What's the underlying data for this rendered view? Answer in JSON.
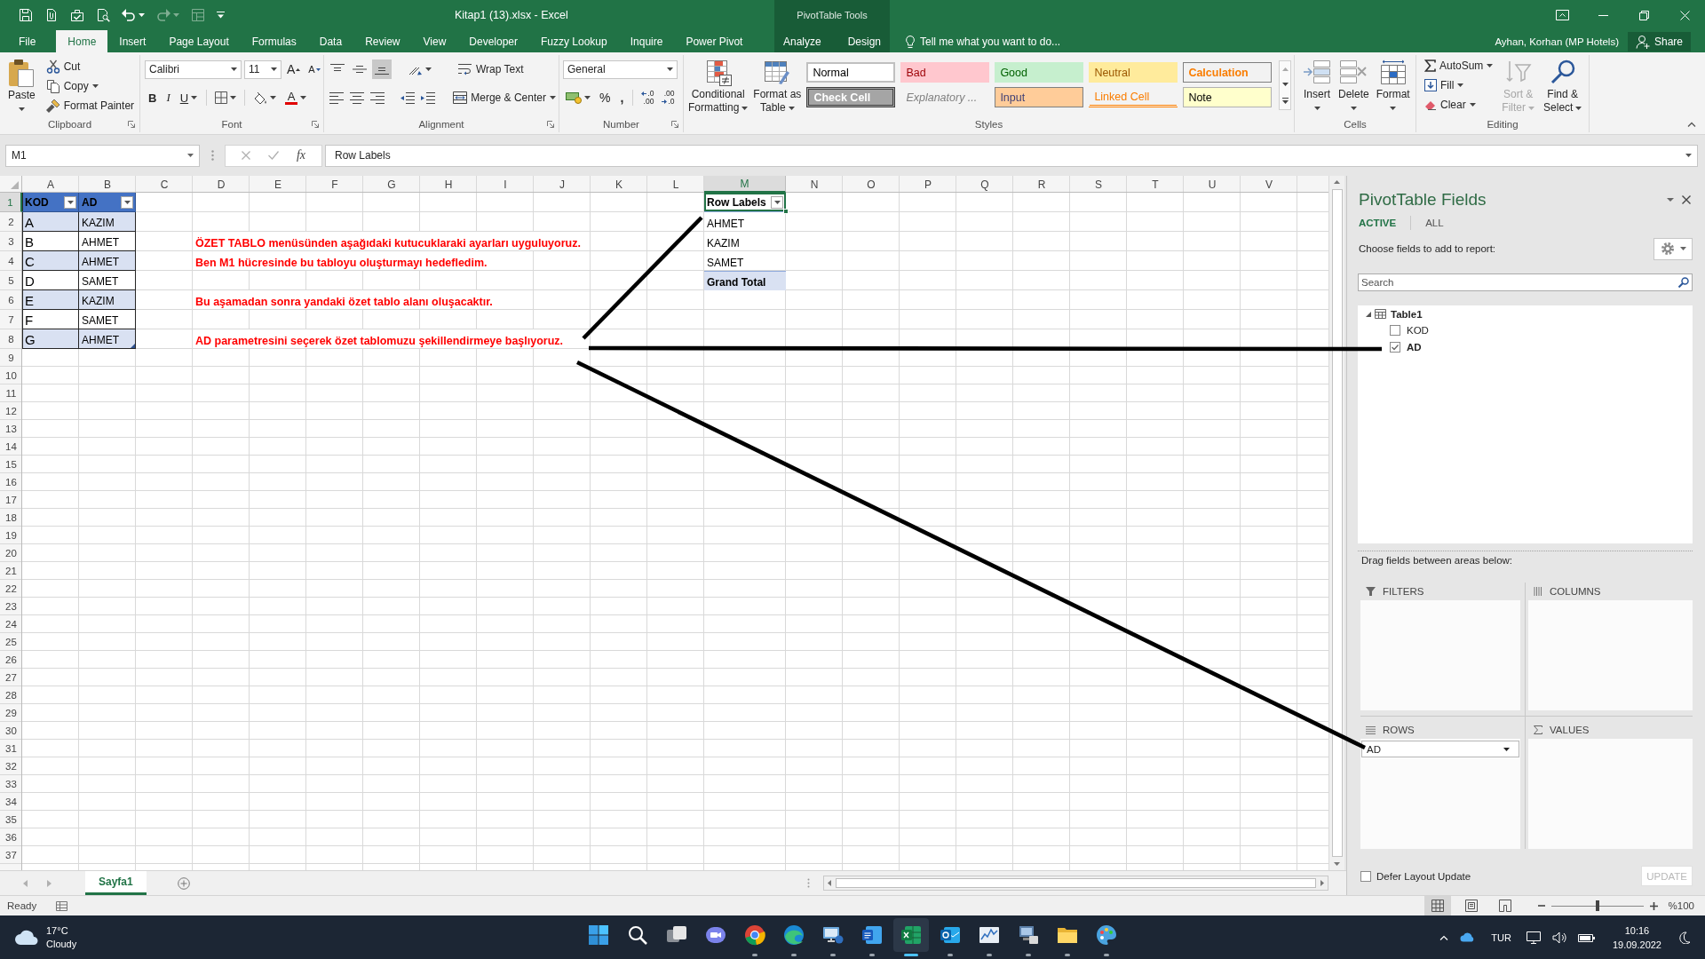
{
  "title_bar": {
    "quick_access": [
      {
        "kind": "save",
        "disabled": false
      },
      {
        "kind": "attach",
        "disabled": false
      },
      {
        "kind": "check",
        "disabled": false
      },
      {
        "kind": "print_preview",
        "disabled": false
      },
      {
        "kind": "undo",
        "disabled": false
      },
      {
        "kind": "redo",
        "disabled": true
      },
      {
        "kind": "form",
        "disabled": true
      },
      {
        "kind": "customize",
        "disabled": false
      }
    ],
    "title": "Kitap1 (13).xlsx - Excel",
    "context_group": "PivotTable Tools"
  },
  "ribbon_tabs": [
    {
      "label": "File",
      "selected": false
    },
    {
      "label": "Home",
      "selected": true
    },
    {
      "label": "Insert",
      "selected": false
    },
    {
      "label": "Page Layout",
      "selected": false
    },
    {
      "label": "Formulas",
      "selected": false
    },
    {
      "label": "Data",
      "selected": false
    },
    {
      "label": "Review",
      "selected": false
    },
    {
      "label": "View",
      "selected": false
    },
    {
      "label": "Developer",
      "selected": false
    },
    {
      "label": "Fuzzy Lookup",
      "selected": false
    },
    {
      "label": "Inquire",
      "selected": false
    },
    {
      "label": "Power Pivot",
      "selected": false
    }
  ],
  "context_tabs": [
    {
      "label": "Analyze",
      "selected": false
    },
    {
      "label": "Design",
      "selected": false
    }
  ],
  "tell_me": "Tell me what you want to do...",
  "account": {
    "user": "Ayhan, Korhan (MP Hotels)",
    "share": "Share"
  },
  "ribbon": {
    "clipboard": {
      "label": "Clipboard",
      "paste": "Paste",
      "cut": "Cut",
      "copy": "Copy",
      "format_painter": "Format Painter"
    },
    "font": {
      "label": "Font",
      "font_name": "Calibri",
      "font_size": "11",
      "grow_font": "A",
      "shrink_font": "A",
      "bold": "B",
      "italic": "I",
      "underline": "U",
      "font_color": "A"
    },
    "alignment": {
      "label": "Alignment",
      "vertical": [
        {
          "kind": "top",
          "selected": false
        },
        {
          "kind": "middle",
          "selected": false
        },
        {
          "kind": "bottom",
          "selected": true
        }
      ],
      "horizontal": [
        {
          "kind": "left"
        },
        {
          "kind": "center"
        },
        {
          "kind": "right"
        }
      ],
      "wrap_text": "Wrap Text",
      "merge": "Merge & Center"
    },
    "number": {
      "label": "Number",
      "format": "General",
      "percent": "%",
      "comma": ",",
      "increase_decimal": [
        ".0",
        ".00"
      ],
      "decrease_decimal": [
        ".00",
        ".0"
      ]
    },
    "styles": {
      "label": "Styles",
      "conditional_formatting": [
        "Conditional",
        "Formatting"
      ],
      "format_as_table": [
        "Format as",
        "Table"
      ],
      "gallery": [
        {
          "label": "Normal",
          "kind": "normal"
        },
        {
          "label": "Bad",
          "kind": "bad"
        },
        {
          "label": "Good",
          "kind": "good"
        },
        {
          "label": "Neutral",
          "kind": "neutral"
        },
        {
          "label": "Calculation",
          "kind": "calculation"
        },
        {
          "label": "Check Cell",
          "kind": "check"
        },
        {
          "label": "Explanatory ...",
          "kind": "explanatory"
        },
        {
          "label": "Input",
          "kind": "input"
        },
        {
          "label": "Linked Cell",
          "kind": "linked"
        },
        {
          "label": "Note",
          "kind": "note"
        }
      ]
    },
    "cells": {
      "label": "Cells",
      "buttons": [
        {
          "kind": "insert",
          "label": "Insert"
        },
        {
          "kind": "delete",
          "label": "Delete"
        },
        {
          "kind": "format",
          "label": "Format"
        }
      ]
    },
    "editing": {
      "label": "Editing",
      "autosum": "AutoSum",
      "fill": "Fill",
      "clear": "Clear",
      "sort_filter": {
        "lines": [
          "Sort &",
          "Filter"
        ],
        "disabled": true
      },
      "find_select": [
        "Find &",
        "Select"
      ]
    }
  },
  "formula_bar": {
    "name_box": "M1",
    "function_label": "fx",
    "formula": "Row Labels"
  },
  "sheet": {
    "columns": [
      {
        "label": "A",
        "selected": false
      },
      {
        "label": "B",
        "selected": false
      },
      {
        "label": "C",
        "selected": false
      },
      {
        "label": "D",
        "selected": false
      },
      {
        "label": "E",
        "selected": false
      },
      {
        "label": "F",
        "selected": false
      },
      {
        "label": "G",
        "selected": false
      },
      {
        "label": "H",
        "selected": false
      },
      {
        "label": "I",
        "selected": false
      },
      {
        "label": "J",
        "selected": false
      },
      {
        "label": "K",
        "selected": false
      },
      {
        "label": "L",
        "selected": false
      },
      {
        "label": "M",
        "selected": true
      },
      {
        "label": "N",
        "selected": false
      },
      {
        "label": "O",
        "selected": false
      },
      {
        "label": "P",
        "selected": false
      },
      {
        "label": "Q",
        "selected": false
      },
      {
        "label": "R",
        "selected": false
      },
      {
        "label": "S",
        "selected": false
      },
      {
        "label": "T",
        "selected": false
      },
      {
        "label": "U",
        "selected": false
      },
      {
        "label": "V",
        "selected": false
      }
    ],
    "rows": [
      {
        "label": "1",
        "selected": true
      },
      {
        "label": "2",
        "selected": false
      },
      {
        "label": "3",
        "selected": false
      },
      {
        "label": "4",
        "selected": false
      },
      {
        "label": "5",
        "selected": false
      },
      {
        "label": "6",
        "selected": false
      },
      {
        "label": "7",
        "selected": false
      },
      {
        "label": "8",
        "selected": false
      },
      {
        "label": "9",
        "selected": false
      },
      {
        "label": "10",
        "selected": false
      },
      {
        "label": "11",
        "selected": false
      },
      {
        "label": "12",
        "selected": false
      },
      {
        "label": "13",
        "selected": false
      },
      {
        "label": "14",
        "selected": false
      },
      {
        "label": "15",
        "selected": false
      },
      {
        "label": "16",
        "selected": false
      },
      {
        "label": "17",
        "selected": false
      },
      {
        "label": "18",
        "selected": false
      },
      {
        "label": "19",
        "selected": false
      },
      {
        "label": "20",
        "selected": false
      },
      {
        "label": "21",
        "selected": false
      },
      {
        "label": "22",
        "selected": false
      },
      {
        "label": "23",
        "selected": false
      },
      {
        "label": "24",
        "selected": false
      },
      {
        "label": "25",
        "selected": false
      },
      {
        "label": "26",
        "selected": false
      },
      {
        "label": "27",
        "selected": false
      },
      {
        "label": "28",
        "selected": false
      },
      {
        "label": "29",
        "selected": false
      },
      {
        "label": "30",
        "selected": false
      },
      {
        "label": "31",
        "selected": false
      },
      {
        "label": "32",
        "selected": false
      },
      {
        "label": "33",
        "selected": false
      },
      {
        "label": "34",
        "selected": false
      },
      {
        "label": "35",
        "selected": false
      },
      {
        "label": "36",
        "selected": false
      },
      {
        "label": "37",
        "selected": false
      }
    ],
    "table": {
      "headers": [
        "KOD",
        "AD"
      ],
      "rows": [
        [
          "A",
          "KAZIM"
        ],
        [
          "B",
          "AHMET"
        ],
        [
          "C",
          "AHMET"
        ],
        [
          "D",
          "SAMET"
        ],
        [
          "E",
          "KAZIM"
        ],
        [
          "F",
          "SAMET"
        ],
        [
          "G",
          "AHMET"
        ]
      ]
    },
    "notes": [
      "ÖZET TABLO menüsünden aşağıdaki kutucuklaraki ayarları uyguluyoruz.",
      "Ben M1 hücresinde bu tabloyu oluşturmayı hedefledim.",
      "Bu aşamadan sonra yandaki özet tablo alanı oluşacaktır.",
      "AD parametresini seçerek özet tablomuzu şekillendirmeye başlıyoruz."
    ],
    "pivot_table": {
      "header": {
        "label": "Row Labels",
        "selected": true
      },
      "items": [
        "AHMET",
        "KAZIM",
        "SAMET"
      ],
      "total": "Grand Total"
    }
  },
  "sheet_tabs": [
    {
      "label": "Sayfa1",
      "selected": true
    }
  ],
  "status_bar": {
    "status": "Ready",
    "views": [
      {
        "kind": "normal",
        "selected": true
      },
      {
        "kind": "page_layout",
        "selected": false
      },
      {
        "kind": "page_break",
        "selected": false
      }
    ],
    "zoom": {
      "level": 0.5,
      "reading": "%100"
    }
  },
  "pivot_fields": {
    "title": "PivotTable Fields",
    "tabs": [
      {
        "label": "ACTIVE",
        "selected": true
      },
      {
        "label": "ALL",
        "selected": false
      }
    ],
    "instruction": "Choose fields to add to report:",
    "search": {
      "placeholder": "Search"
    },
    "tables": [
      {
        "name": "Table1",
        "expanded": true,
        "fields": [
          {
            "label": "KOD",
            "checked": false
          },
          {
            "label": "AD",
            "checked": true
          }
        ]
      }
    ],
    "areas_hint": "Drag fields between areas below:",
    "areas": [
      {
        "kind": "filters",
        "label": "FILTERS"
      },
      {
        "kind": "columns",
        "label": "COLUMNS"
      },
      {
        "kind": "rows",
        "label": "ROWS",
        "items": [
          "AD"
        ]
      },
      {
        "kind": "values",
        "label": "VALUES"
      }
    ],
    "defer_update": {
      "label": "Defer Layout Update",
      "checked": false
    },
    "update_button": {
      "label": "UPDATE",
      "disabled": true
    }
  },
  "taskbar": {
    "weather": {
      "temperature": "17°C",
      "condition": "Cloudy"
    },
    "apps": [
      {
        "kind": "start",
        "running": false,
        "selected": false
      },
      {
        "kind": "search",
        "running": false,
        "selected": false
      },
      {
        "kind": "task_view",
        "running": false,
        "selected": false
      },
      {
        "kind": "chat",
        "running": false,
        "selected": false
      },
      {
        "kind": "browser",
        "running": true,
        "selected": false
      },
      {
        "kind": "browser_wave",
        "running": true,
        "selected": false
      },
      {
        "kind": "remote_app",
        "running": true,
        "selected": false
      },
      {
        "kind": "document",
        "running": true,
        "selected": false
      },
      {
        "kind": "spreadsheet",
        "running": true,
        "selected": true
      },
      {
        "kind": "mail",
        "running": true,
        "selected": false
      },
      {
        "kind": "chart_app",
        "running": true,
        "selected": false
      },
      {
        "kind": "computer_app",
        "running": true,
        "selected": false
      },
      {
        "kind": "folder",
        "running": true,
        "selected": false
      },
      {
        "kind": "paint",
        "running": true,
        "selected": false
      }
    ],
    "tray": {
      "language": "TUR",
      "time": "10:16",
      "date": "19.09.2022"
    }
  }
}
